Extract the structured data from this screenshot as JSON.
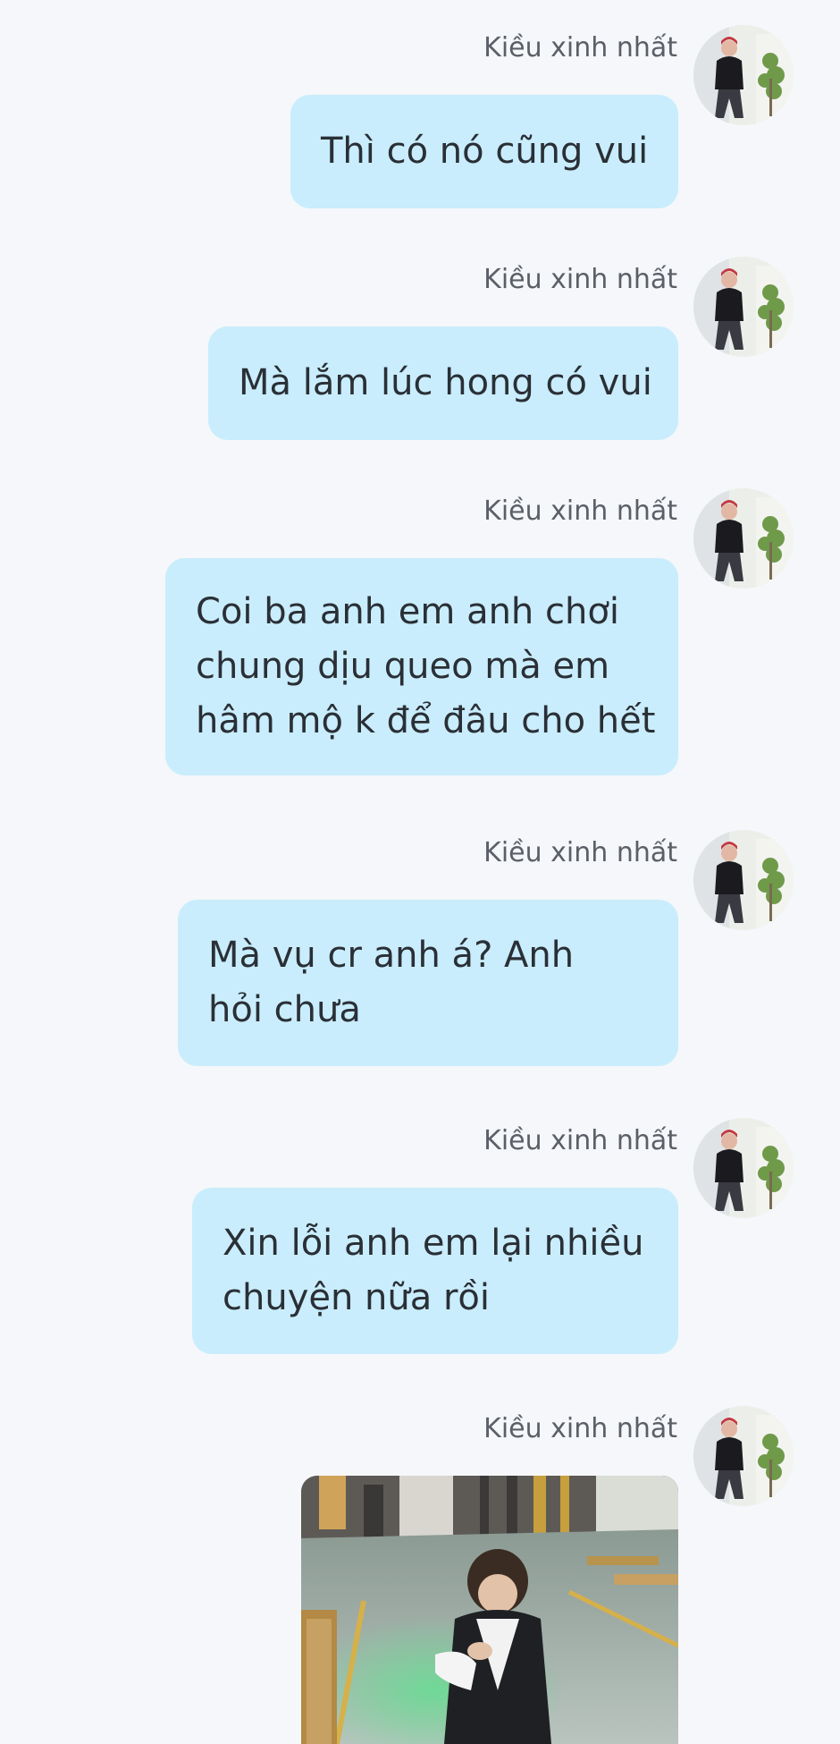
{
  "chat": {
    "sender_name": "Kiều xinh nhất",
    "bubble_color": "#c9edfc",
    "background_color": "#f5f7fa",
    "messages": [
      {
        "type": "text",
        "lines": [
          "Thì có nó cũng vui"
        ]
      },
      {
        "type": "text",
        "lines": [
          "Mà lắm lúc hong có vui"
        ]
      },
      {
        "type": "text",
        "lines": [
          "Coi ba anh em anh chơi",
          "chung dịu queo mà em",
          "hâm mộ k để đâu cho hết"
        ]
      },
      {
        "type": "text",
        "lines": [
          "Mà vụ cr anh á? Anh",
          "hỏi chưa"
        ]
      },
      {
        "type": "text",
        "lines": [
          "Xin lỗi anh em lại nhiều",
          "chuyện nữa rồi"
        ]
      },
      {
        "type": "image",
        "icon": "photo-thumbnail"
      }
    ]
  }
}
